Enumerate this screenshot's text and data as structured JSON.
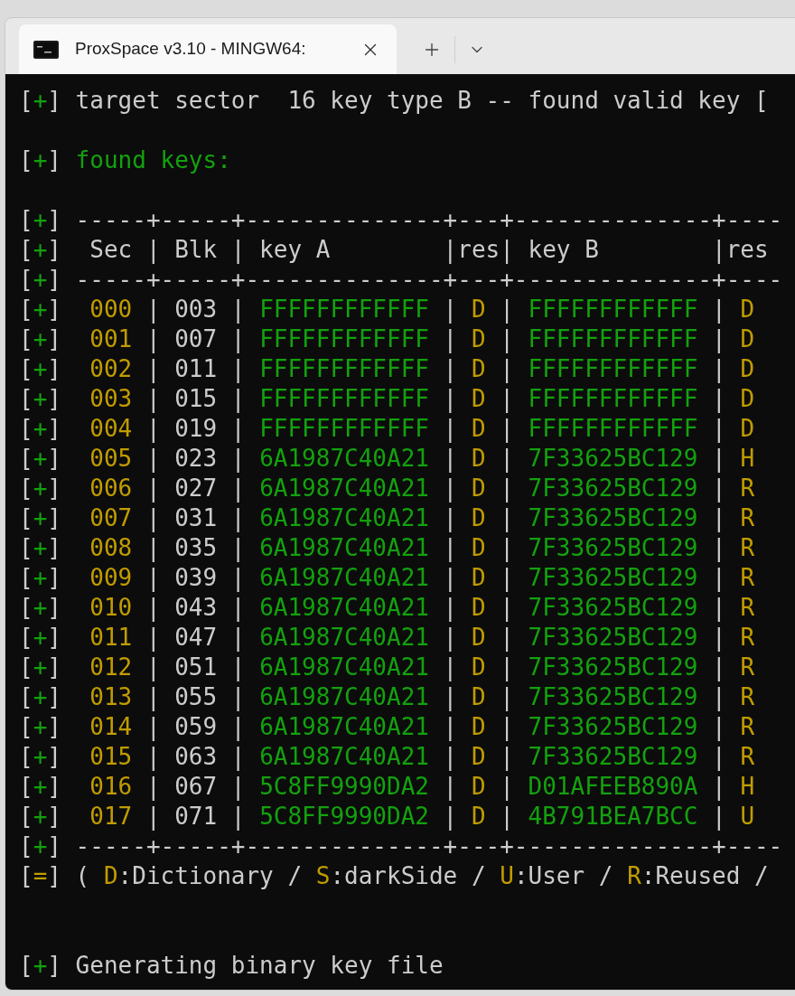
{
  "window": {
    "tab": {
      "title": "ProxSpace v3.10 - MINGW64:",
      "selected": true
    }
  },
  "terminal": {
    "lines": [
      {
        "kind": "output",
        "marker": {
          "open": "[",
          "symbol": "+",
          "close": "]",
          "color": "#13a10e"
        },
        "segments": [
          {
            "text": "target sector  16 key type B -- found valid key [",
            "color": "#cccccc"
          }
        ]
      },
      {
        "kind": "blank"
      },
      {
        "kind": "output",
        "marker": {
          "open": "[",
          "symbol": "+",
          "close": "]",
          "color": "#13a10e"
        },
        "segments": [
          {
            "text": "found keys:",
            "color": "#13a10e"
          }
        ]
      },
      {
        "kind": "blank"
      },
      {
        "kind": "output",
        "marker": {
          "open": "[",
          "symbol": "+",
          "close": "]",
          "color": "#13a10e"
        },
        "segments": [
          {
            "text": "-----+-----+--------------+---+--------------+----",
            "color": "#cccccc"
          }
        ]
      },
      {
        "kind": "output",
        "marker": {
          "open": "[",
          "symbol": "+",
          "close": "]",
          "color": "#13a10e"
        },
        "segments": [
          {
            "text": " Sec | Blk | key A        |res| key B        |res",
            "color": "#cccccc"
          }
        ]
      },
      {
        "kind": "output",
        "marker": {
          "open": "[",
          "symbol": "+",
          "close": "]",
          "color": "#13a10e"
        },
        "segments": [
          {
            "text": "-----+-----+--------------+---+--------------+----",
            "color": "#cccccc"
          }
        ]
      },
      {
        "kind": "output",
        "marker": {
          "open": "[",
          "symbol": "+",
          "close": "]",
          "color": "#13a10e"
        },
        "segments": [
          {
            "text": " 000",
            "color": "#c19c00"
          },
          {
            "text": " | 003 | ",
            "color": "#cccccc"
          },
          {
            "text": "FFFFFFFFFFFF",
            "color": "#13a10e"
          },
          {
            "text": " | ",
            "color": "#cccccc"
          },
          {
            "text": "D",
            "color": "#c19c00"
          },
          {
            "text": " | ",
            "color": "#cccccc"
          },
          {
            "text": "FFFFFFFFFFFF",
            "color": "#13a10e"
          },
          {
            "text": " | ",
            "color": "#cccccc"
          },
          {
            "text": "D",
            "color": "#c19c00"
          }
        ]
      },
      {
        "kind": "output",
        "marker": {
          "open": "[",
          "symbol": "+",
          "close": "]",
          "color": "#13a10e"
        },
        "segments": [
          {
            "text": " 001",
            "color": "#c19c00"
          },
          {
            "text": " | 007 | ",
            "color": "#cccccc"
          },
          {
            "text": "FFFFFFFFFFFF",
            "color": "#13a10e"
          },
          {
            "text": " | ",
            "color": "#cccccc"
          },
          {
            "text": "D",
            "color": "#c19c00"
          },
          {
            "text": " | ",
            "color": "#cccccc"
          },
          {
            "text": "FFFFFFFFFFFF",
            "color": "#13a10e"
          },
          {
            "text": " | ",
            "color": "#cccccc"
          },
          {
            "text": "D",
            "color": "#c19c00"
          }
        ]
      },
      {
        "kind": "output",
        "marker": {
          "open": "[",
          "symbol": "+",
          "close": "]",
          "color": "#13a10e"
        },
        "segments": [
          {
            "text": " 002",
            "color": "#c19c00"
          },
          {
            "text": " | 011 | ",
            "color": "#cccccc"
          },
          {
            "text": "FFFFFFFFFFFF",
            "color": "#13a10e"
          },
          {
            "text": " | ",
            "color": "#cccccc"
          },
          {
            "text": "D",
            "color": "#c19c00"
          },
          {
            "text": " | ",
            "color": "#cccccc"
          },
          {
            "text": "FFFFFFFFFFFF",
            "color": "#13a10e"
          },
          {
            "text": " | ",
            "color": "#cccccc"
          },
          {
            "text": "D",
            "color": "#c19c00"
          }
        ]
      },
      {
        "kind": "output",
        "marker": {
          "open": "[",
          "symbol": "+",
          "close": "]",
          "color": "#13a10e"
        },
        "segments": [
          {
            "text": " 003",
            "color": "#c19c00"
          },
          {
            "text": " | 015 | ",
            "color": "#cccccc"
          },
          {
            "text": "FFFFFFFFFFFF",
            "color": "#13a10e"
          },
          {
            "text": " | ",
            "color": "#cccccc"
          },
          {
            "text": "D",
            "color": "#c19c00"
          },
          {
            "text": " | ",
            "color": "#cccccc"
          },
          {
            "text": "FFFFFFFFFFFF",
            "color": "#13a10e"
          },
          {
            "text": " | ",
            "color": "#cccccc"
          },
          {
            "text": "D",
            "color": "#c19c00"
          }
        ]
      },
      {
        "kind": "output",
        "marker": {
          "open": "[",
          "symbol": "+",
          "close": "]",
          "color": "#13a10e"
        },
        "segments": [
          {
            "text": " 004",
            "color": "#c19c00"
          },
          {
            "text": " | 019 | ",
            "color": "#cccccc"
          },
          {
            "text": "FFFFFFFFFFFF",
            "color": "#13a10e"
          },
          {
            "text": " | ",
            "color": "#cccccc"
          },
          {
            "text": "D",
            "color": "#c19c00"
          },
          {
            "text": " | ",
            "color": "#cccccc"
          },
          {
            "text": "FFFFFFFFFFFF",
            "color": "#13a10e"
          },
          {
            "text": " | ",
            "color": "#cccccc"
          },
          {
            "text": "D",
            "color": "#c19c00"
          }
        ]
      },
      {
        "kind": "output",
        "marker": {
          "open": "[",
          "symbol": "+",
          "close": "]",
          "color": "#13a10e"
        },
        "segments": [
          {
            "text": " 005",
            "color": "#c19c00"
          },
          {
            "text": " | 023 | ",
            "color": "#cccccc"
          },
          {
            "text": "6A1987C40A21",
            "color": "#13a10e"
          },
          {
            "text": " | ",
            "color": "#cccccc"
          },
          {
            "text": "D",
            "color": "#c19c00"
          },
          {
            "text": " | ",
            "color": "#cccccc"
          },
          {
            "text": "7F33625BC129",
            "color": "#13a10e"
          },
          {
            "text": " | ",
            "color": "#cccccc"
          },
          {
            "text": "H",
            "color": "#c19c00"
          }
        ]
      },
      {
        "kind": "output",
        "marker": {
          "open": "[",
          "symbol": "+",
          "close": "]",
          "color": "#13a10e"
        },
        "segments": [
          {
            "text": " 006",
            "color": "#c19c00"
          },
          {
            "text": " | 027 | ",
            "color": "#cccccc"
          },
          {
            "text": "6A1987C40A21",
            "color": "#13a10e"
          },
          {
            "text": " | ",
            "color": "#cccccc"
          },
          {
            "text": "D",
            "color": "#c19c00"
          },
          {
            "text": " | ",
            "color": "#cccccc"
          },
          {
            "text": "7F33625BC129",
            "color": "#13a10e"
          },
          {
            "text": " | ",
            "color": "#cccccc"
          },
          {
            "text": "R",
            "color": "#c19c00"
          }
        ]
      },
      {
        "kind": "output",
        "marker": {
          "open": "[",
          "symbol": "+",
          "close": "]",
          "color": "#13a10e"
        },
        "segments": [
          {
            "text": " 007",
            "color": "#c19c00"
          },
          {
            "text": " | 031 | ",
            "color": "#cccccc"
          },
          {
            "text": "6A1987C40A21",
            "color": "#13a10e"
          },
          {
            "text": " | ",
            "color": "#cccccc"
          },
          {
            "text": "D",
            "color": "#c19c00"
          },
          {
            "text": " | ",
            "color": "#cccccc"
          },
          {
            "text": "7F33625BC129",
            "color": "#13a10e"
          },
          {
            "text": " | ",
            "color": "#cccccc"
          },
          {
            "text": "R",
            "color": "#c19c00"
          }
        ]
      },
      {
        "kind": "output",
        "marker": {
          "open": "[",
          "symbol": "+",
          "close": "]",
          "color": "#13a10e"
        },
        "segments": [
          {
            "text": " 008",
            "color": "#c19c00"
          },
          {
            "text": " | 035 | ",
            "color": "#cccccc"
          },
          {
            "text": "6A1987C40A21",
            "color": "#13a10e"
          },
          {
            "text": " | ",
            "color": "#cccccc"
          },
          {
            "text": "D",
            "color": "#c19c00"
          },
          {
            "text": " | ",
            "color": "#cccccc"
          },
          {
            "text": "7F33625BC129",
            "color": "#13a10e"
          },
          {
            "text": " | ",
            "color": "#cccccc"
          },
          {
            "text": "R",
            "color": "#c19c00"
          }
        ]
      },
      {
        "kind": "output",
        "marker": {
          "open": "[",
          "symbol": "+",
          "close": "]",
          "color": "#13a10e"
        },
        "segments": [
          {
            "text": " 009",
            "color": "#c19c00"
          },
          {
            "text": " | 039 | ",
            "color": "#cccccc"
          },
          {
            "text": "6A1987C40A21",
            "color": "#13a10e"
          },
          {
            "text": " | ",
            "color": "#cccccc"
          },
          {
            "text": "D",
            "color": "#c19c00"
          },
          {
            "text": " | ",
            "color": "#cccccc"
          },
          {
            "text": "7F33625BC129",
            "color": "#13a10e"
          },
          {
            "text": " | ",
            "color": "#cccccc"
          },
          {
            "text": "R",
            "color": "#c19c00"
          }
        ]
      },
      {
        "kind": "output",
        "marker": {
          "open": "[",
          "symbol": "+",
          "close": "]",
          "color": "#13a10e"
        },
        "segments": [
          {
            "text": " 010",
            "color": "#c19c00"
          },
          {
            "text": " | 043 | ",
            "color": "#cccccc"
          },
          {
            "text": "6A1987C40A21",
            "color": "#13a10e"
          },
          {
            "text": " | ",
            "color": "#cccccc"
          },
          {
            "text": "D",
            "color": "#c19c00"
          },
          {
            "text": " | ",
            "color": "#cccccc"
          },
          {
            "text": "7F33625BC129",
            "color": "#13a10e"
          },
          {
            "text": " | ",
            "color": "#cccccc"
          },
          {
            "text": "R",
            "color": "#c19c00"
          }
        ]
      },
      {
        "kind": "output",
        "marker": {
          "open": "[",
          "symbol": "+",
          "close": "]",
          "color": "#13a10e"
        },
        "segments": [
          {
            "text": " 011",
            "color": "#c19c00"
          },
          {
            "text": " | 047 | ",
            "color": "#cccccc"
          },
          {
            "text": "6A1987C40A21",
            "color": "#13a10e"
          },
          {
            "text": " | ",
            "color": "#cccccc"
          },
          {
            "text": "D",
            "color": "#c19c00"
          },
          {
            "text": " | ",
            "color": "#cccccc"
          },
          {
            "text": "7F33625BC129",
            "color": "#13a10e"
          },
          {
            "text": " | ",
            "color": "#cccccc"
          },
          {
            "text": "R",
            "color": "#c19c00"
          }
        ]
      },
      {
        "kind": "output",
        "marker": {
          "open": "[",
          "symbol": "+",
          "close": "]",
          "color": "#13a10e"
        },
        "segments": [
          {
            "text": " 012",
            "color": "#c19c00"
          },
          {
            "text": " | 051 | ",
            "color": "#cccccc"
          },
          {
            "text": "6A1987C40A21",
            "color": "#13a10e"
          },
          {
            "text": " | ",
            "color": "#cccccc"
          },
          {
            "text": "D",
            "color": "#c19c00"
          },
          {
            "text": " | ",
            "color": "#cccccc"
          },
          {
            "text": "7F33625BC129",
            "color": "#13a10e"
          },
          {
            "text": " | ",
            "color": "#cccccc"
          },
          {
            "text": "R",
            "color": "#c19c00"
          }
        ]
      },
      {
        "kind": "output",
        "marker": {
          "open": "[",
          "symbol": "+",
          "close": "]",
          "color": "#13a10e"
        },
        "segments": [
          {
            "text": " 013",
            "color": "#c19c00"
          },
          {
            "text": " | 055 | ",
            "color": "#cccccc"
          },
          {
            "text": "6A1987C40A21",
            "color": "#13a10e"
          },
          {
            "text": " | ",
            "color": "#cccccc"
          },
          {
            "text": "D",
            "color": "#c19c00"
          },
          {
            "text": " | ",
            "color": "#cccccc"
          },
          {
            "text": "7F33625BC129",
            "color": "#13a10e"
          },
          {
            "text": " | ",
            "color": "#cccccc"
          },
          {
            "text": "R",
            "color": "#c19c00"
          }
        ]
      },
      {
        "kind": "output",
        "marker": {
          "open": "[",
          "symbol": "+",
          "close": "]",
          "color": "#13a10e"
        },
        "segments": [
          {
            "text": " 014",
            "color": "#c19c00"
          },
          {
            "text": " | 059 | ",
            "color": "#cccccc"
          },
          {
            "text": "6A1987C40A21",
            "color": "#13a10e"
          },
          {
            "text": " | ",
            "color": "#cccccc"
          },
          {
            "text": "D",
            "color": "#c19c00"
          },
          {
            "text": " | ",
            "color": "#cccccc"
          },
          {
            "text": "7F33625BC129",
            "color": "#13a10e"
          },
          {
            "text": " | ",
            "color": "#cccccc"
          },
          {
            "text": "R",
            "color": "#c19c00"
          }
        ]
      },
      {
        "kind": "output",
        "marker": {
          "open": "[",
          "symbol": "+",
          "close": "]",
          "color": "#13a10e"
        },
        "segments": [
          {
            "text": " 015",
            "color": "#c19c00"
          },
          {
            "text": " | 063 | ",
            "color": "#cccccc"
          },
          {
            "text": "6A1987C40A21",
            "color": "#13a10e"
          },
          {
            "text": " | ",
            "color": "#cccccc"
          },
          {
            "text": "D",
            "color": "#c19c00"
          },
          {
            "text": " | ",
            "color": "#cccccc"
          },
          {
            "text": "7F33625BC129",
            "color": "#13a10e"
          },
          {
            "text": " | ",
            "color": "#cccccc"
          },
          {
            "text": "R",
            "color": "#c19c00"
          }
        ]
      },
      {
        "kind": "output",
        "marker": {
          "open": "[",
          "symbol": "+",
          "close": "]",
          "color": "#13a10e"
        },
        "segments": [
          {
            "text": " 016",
            "color": "#c19c00"
          },
          {
            "text": " | 067 | ",
            "color": "#cccccc"
          },
          {
            "text": "5C8FF9990DA2",
            "color": "#13a10e"
          },
          {
            "text": " | ",
            "color": "#cccccc"
          },
          {
            "text": "D",
            "color": "#c19c00"
          },
          {
            "text": " | ",
            "color": "#cccccc"
          },
          {
            "text": "D01AFEEB890A",
            "color": "#13a10e"
          },
          {
            "text": " | ",
            "color": "#cccccc"
          },
          {
            "text": "H",
            "color": "#c19c00"
          }
        ]
      },
      {
        "kind": "output",
        "marker": {
          "open": "[",
          "symbol": "+",
          "close": "]",
          "color": "#13a10e"
        },
        "segments": [
          {
            "text": " 017",
            "color": "#c19c00"
          },
          {
            "text": " | 071 | ",
            "color": "#cccccc"
          },
          {
            "text": "5C8FF9990DA2",
            "color": "#13a10e"
          },
          {
            "text": " | ",
            "color": "#cccccc"
          },
          {
            "text": "D",
            "color": "#c19c00"
          },
          {
            "text": " | ",
            "color": "#cccccc"
          },
          {
            "text": "4B791BEA7BCC",
            "color": "#13a10e"
          },
          {
            "text": " | ",
            "color": "#cccccc"
          },
          {
            "text": "U",
            "color": "#c19c00"
          }
        ]
      },
      {
        "kind": "output",
        "marker": {
          "open": "[",
          "symbol": "+",
          "close": "]",
          "color": "#13a10e"
        },
        "segments": [
          {
            "text": "-----+-----+--------------+---+--------------+----",
            "color": "#cccccc"
          }
        ]
      },
      {
        "kind": "output",
        "marker": {
          "open": "[",
          "symbol": "=",
          "close": "]",
          "color": "#c19c00"
        },
        "segments": [
          {
            "text": "( ",
            "color": "#cccccc"
          },
          {
            "text": "D",
            "color": "#c19c00"
          },
          {
            "text": ":Dictionary / ",
            "color": "#cccccc"
          },
          {
            "text": "S",
            "color": "#c19c00"
          },
          {
            "text": ":darkSide / ",
            "color": "#cccccc"
          },
          {
            "text": "U",
            "color": "#c19c00"
          },
          {
            "text": ":User / ",
            "color": "#cccccc"
          },
          {
            "text": "R",
            "color": "#c19c00"
          },
          {
            "text": ":Reused /",
            "color": "#cccccc"
          }
        ]
      },
      {
        "kind": "blank"
      },
      {
        "kind": "blank"
      },
      {
        "kind": "output",
        "marker": {
          "open": "[",
          "symbol": "+",
          "close": "]",
          "color": "#13a10e"
        },
        "segments": [
          {
            "text": "Generating binary key file",
            "color": "#cccccc"
          }
        ]
      }
    ]
  }
}
